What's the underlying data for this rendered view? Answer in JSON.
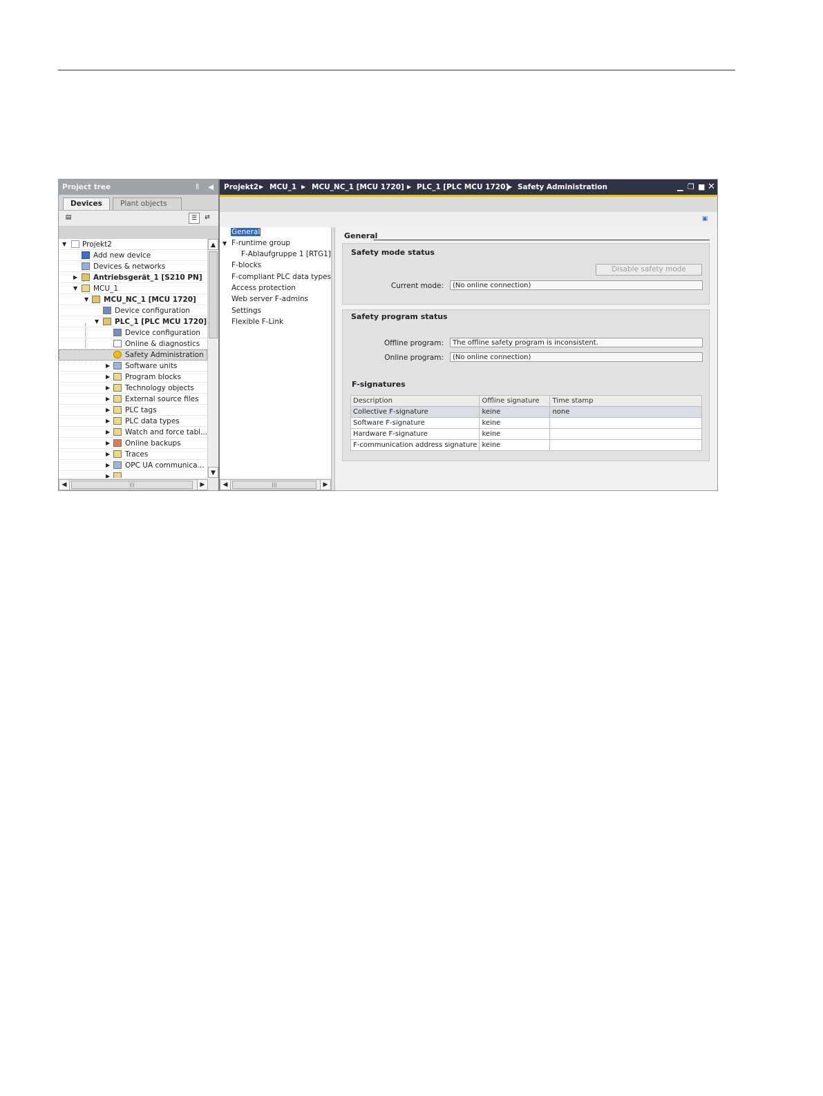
{
  "project_tree": {
    "title": "Project tree",
    "tabs": [
      "Devices",
      "Plant objects"
    ],
    "items": [
      {
        "label": "Projekt2",
        "bold": false
      },
      {
        "label": "Add new device",
        "bold": false
      },
      {
        "label": "Devices & networks",
        "bold": false
      },
      {
        "label": "Antriebsgerät_1 [S210 PN]",
        "bold": true
      },
      {
        "label": "MCU_1",
        "bold": false
      },
      {
        "label": "MCU_NC_1 [MCU 1720]",
        "bold": true
      },
      {
        "label": "Device configuration",
        "bold": false
      },
      {
        "label": "PLC_1 [PLC MCU 1720]",
        "bold": true
      },
      {
        "label": "Device configuration",
        "bold": false
      },
      {
        "label": "Online & diagnostics",
        "bold": false
      },
      {
        "label": "Safety Administration",
        "bold": false
      },
      {
        "label": "Software units",
        "bold": false
      },
      {
        "label": "Program blocks",
        "bold": false
      },
      {
        "label": "Technology objects",
        "bold": false
      },
      {
        "label": "External source files",
        "bold": false
      },
      {
        "label": "PLC tags",
        "bold": false
      },
      {
        "label": "PLC data types",
        "bold": false
      },
      {
        "label": "Watch and force tabl...",
        "bold": false
      },
      {
        "label": "Online backups",
        "bold": false
      },
      {
        "label": "Traces",
        "bold": false
      },
      {
        "label": "OPC UA communica...",
        "bold": false
      }
    ]
  },
  "breadcrumb": [
    "Projekt2",
    "MCU_1",
    "MCU_NC_1 [MCU 1720]",
    "PLC_1 [PLC MCU 1720]",
    "Safety Administration"
  ],
  "nav": {
    "items": [
      "General",
      "F-runtime group",
      "F-Ablaufgruppe 1 [RTG1]",
      "F-blocks",
      "F-compliant PLC data types",
      "Access protection",
      "Web server F-admins",
      "Settings",
      "Flexible F-Link"
    ]
  },
  "general": {
    "heading": "General",
    "safety_mode": {
      "title": "Safety mode status",
      "button": "Disable safety mode",
      "current_mode_label": "Current mode:",
      "current_mode_value": "(No online connection)"
    },
    "safety_program": {
      "title": "Safety program status",
      "offline_label": "Offline program:",
      "offline_value": "The offline safety program is inconsistent.",
      "online_label": "Online program:",
      "online_value": "(No online connection)"
    },
    "signatures": {
      "title": "F-signatures",
      "headers": [
        "Description",
        "Offline signature",
        "Time stamp"
      ],
      "rows": [
        [
          "Collective F-signature",
          "keine",
          "none"
        ],
        [
          "Software F-signature",
          "keine",
          ""
        ],
        [
          "Hardware F-signature",
          "keine",
          ""
        ],
        [
          "F-communication address signature",
          "keine",
          ""
        ]
      ]
    }
  }
}
